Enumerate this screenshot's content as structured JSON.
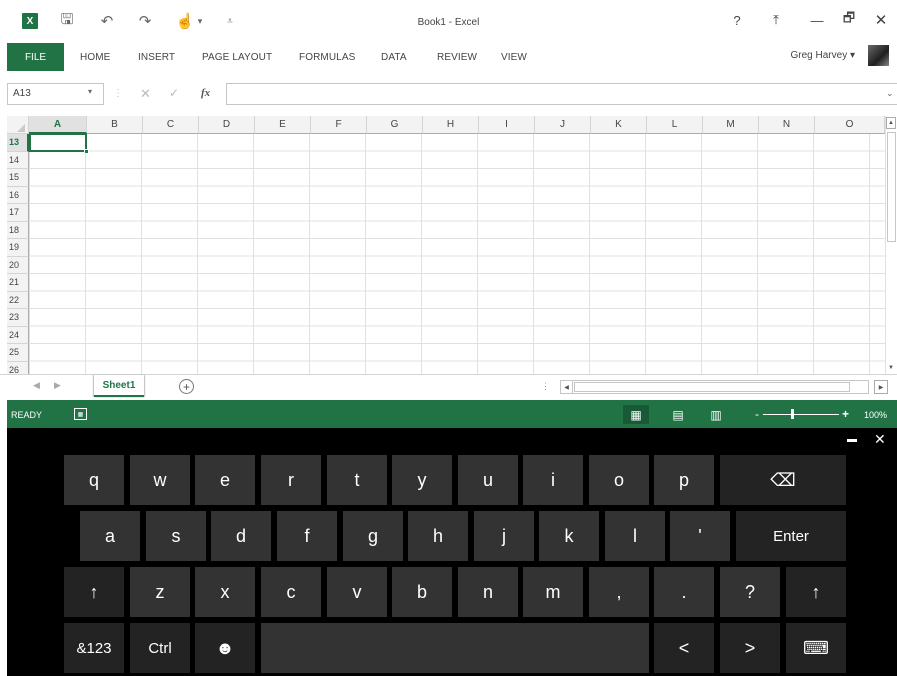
{
  "window": {
    "title": "Book1 - Excel",
    "help": "?",
    "ribbon_display": "⤒",
    "minimize": "—",
    "restore": "🗗",
    "close": "✕",
    "app_logo": "X"
  },
  "qat": {
    "save": "🖫",
    "undo": "↶",
    "redo": "↷",
    "touch_mode": "☝",
    "touch_caret": "▾",
    "customize": "⩡"
  },
  "ribbon": {
    "file": "FILE",
    "tabs": [
      "HOME",
      "INSERT",
      "PAGE LAYOUT",
      "FORMULAS",
      "DATA",
      "REVIEW",
      "VIEW"
    ],
    "user": "Greg Harvey ▾"
  },
  "formula_bar": {
    "name_box": "A13",
    "name_box_arrow": "▾",
    "separator": "⋮",
    "cancel": "✕",
    "enter": "✓",
    "fx": "fx",
    "expand": "⌄",
    "value": ""
  },
  "grid": {
    "columns": [
      "A",
      "B",
      "C",
      "D",
      "E",
      "F",
      "G",
      "H",
      "I",
      "J",
      "K",
      "L",
      "M",
      "N",
      "O"
    ],
    "rows": [
      "13",
      "14",
      "15",
      "16",
      "17",
      "18",
      "19",
      "20",
      "21",
      "22",
      "23",
      "24",
      "25",
      "26"
    ],
    "active_cell": "A13"
  },
  "scrollbars": {
    "up": "▲",
    "down": "▼",
    "left": "◀",
    "right": "▶"
  },
  "sheets": {
    "nav_prev": "◀",
    "nav_next": "▶",
    "tabs": [
      "Sheet1"
    ],
    "new_sheet": "+",
    "split": "⋮"
  },
  "status": {
    "ready": "READY",
    "macro": "▦",
    "view_normal": "▦",
    "view_page_layout": "▤",
    "view_page_break": "▥",
    "zoom_minus": "-",
    "zoom_plus": "+",
    "zoom": "100%",
    "zoom_level_pct": 100
  },
  "keyboard": {
    "dock": "▬",
    "close": "✕",
    "rows": [
      [
        "q",
        "w",
        "e",
        "r",
        "t",
        "y",
        "u",
        "i",
        "o",
        "p",
        "⌫"
      ],
      [
        "a",
        "s",
        "d",
        "f",
        "g",
        "h",
        "j",
        "k",
        "l",
        "'",
        "Enter"
      ],
      [
        "↑",
        "z",
        "x",
        "c",
        "v",
        "b",
        "n",
        "m",
        ",",
        ".",
        "?",
        "↑"
      ],
      [
        "&123",
        "Ctrl",
        "☻",
        "",
        "<",
        ">",
        "⌨"
      ]
    ]
  }
}
